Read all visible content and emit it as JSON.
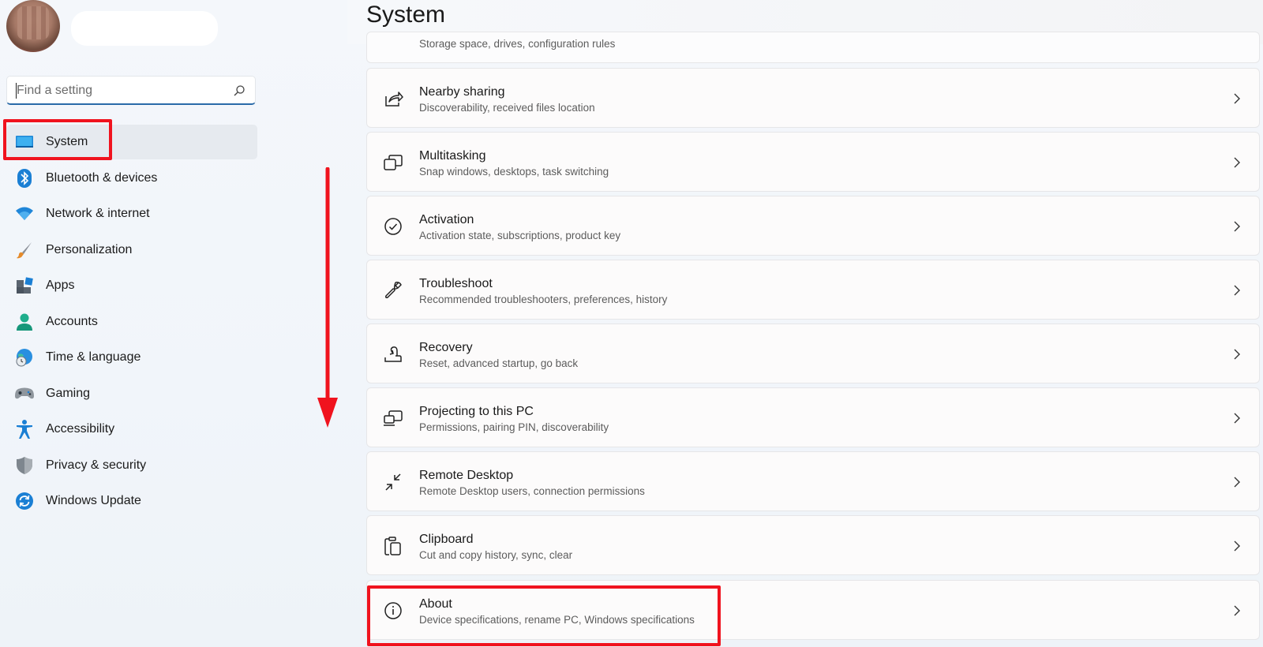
{
  "sidebar": {
    "search": {
      "placeholder": "Find a setting"
    },
    "items": [
      {
        "label": "System",
        "icon": "monitor-icon"
      },
      {
        "label": "Bluetooth & devices",
        "icon": "bluetooth-icon"
      },
      {
        "label": "Network & internet",
        "icon": "wifi-icon"
      },
      {
        "label": "Personalization",
        "icon": "brush-icon"
      },
      {
        "label": "Apps",
        "icon": "apps-icon"
      },
      {
        "label": "Accounts",
        "icon": "person-icon"
      },
      {
        "label": "Time & language",
        "icon": "globe-clock-icon"
      },
      {
        "label": "Gaming",
        "icon": "gamepad-icon"
      },
      {
        "label": "Accessibility",
        "icon": "accessibility-icon"
      },
      {
        "label": "Privacy & security",
        "icon": "shield-icon"
      },
      {
        "label": "Windows Update",
        "icon": "update-icon"
      }
    ]
  },
  "main": {
    "title": "System",
    "partial_card_sub": "Storage space, drives, configuration rules",
    "cards": [
      {
        "title": "Nearby sharing",
        "sub": "Discoverability, received files location",
        "icon": "share-icon"
      },
      {
        "title": "Multitasking",
        "sub": "Snap windows, desktops, task switching",
        "icon": "multitasking-icon"
      },
      {
        "title": "Activation",
        "sub": "Activation state, subscriptions, product key",
        "icon": "check-circle-icon"
      },
      {
        "title": "Troubleshoot",
        "sub": "Recommended troubleshooters, preferences, history",
        "icon": "wrench-icon"
      },
      {
        "title": "Recovery",
        "sub": "Reset, advanced startup, go back",
        "icon": "recovery-icon"
      },
      {
        "title": "Projecting to this PC",
        "sub": "Permissions, pairing PIN, discoverability",
        "icon": "projecting-icon"
      },
      {
        "title": "Remote Desktop",
        "sub": "Remote Desktop users, connection permissions",
        "icon": "remote-desktop-icon"
      },
      {
        "title": "Clipboard",
        "sub": "Cut and copy history, sync, clear",
        "icon": "clipboard-icon"
      },
      {
        "title": "About",
        "sub": "Device specifications, rename PC, Windows specifications",
        "icon": "info-icon"
      }
    ]
  },
  "colors": {
    "highlight": "#f0131e",
    "accent": "#0078d4"
  }
}
